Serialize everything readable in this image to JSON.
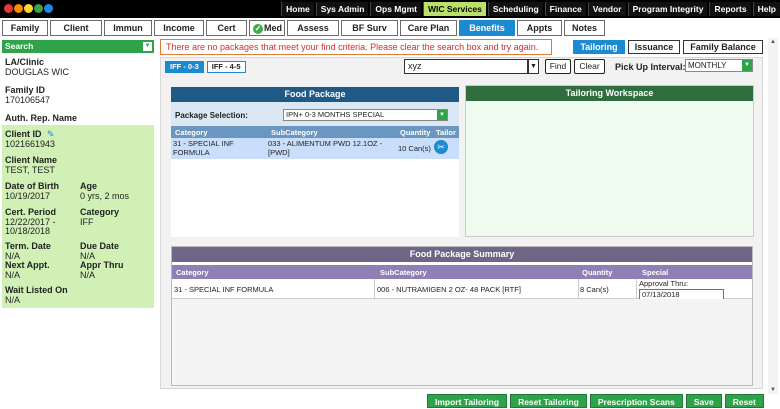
{
  "top_nav": [
    "Home",
    "Sys Admin",
    "Ops Mgmt",
    "WIC Services",
    "Scheduling",
    "Finance",
    "Vendor",
    "Program Integrity",
    "Reports",
    "Help"
  ],
  "top_nav_active": "WIC Services",
  "main_nav": [
    "Family",
    "Client",
    "Immun",
    "Income",
    "Cert",
    "Med",
    "Assess",
    "BF Surv",
    "Care Plan",
    "Benefits",
    "Appts",
    "Notes"
  ],
  "main_nav_active": "Benefits",
  "sidebar": {
    "search_label": "Search",
    "la_clinic_label": "LA/Clinic",
    "la_clinic_value": "DOUGLAS WIC",
    "family_id_label": "Family ID",
    "family_id_value": "170106547",
    "auth_rep_label": "Auth. Rep. Name",
    "client_id_label": "Client ID",
    "client_id_value": "1021661943",
    "client_name_label": "Client Name",
    "client_name_value": "TEST, TEST",
    "dob_label": "Date of Birth",
    "dob_value": "10/19/2017",
    "age_label": "Age",
    "age_value": "0 yrs, 2 mos",
    "cert_period_label": "Cert. Period",
    "cert_period_value_1": "12/22/2017 -",
    "cert_period_value_2": "10/18/2018",
    "category_label": "Category",
    "category_value": "IFF",
    "term_date_label": "Term. Date",
    "term_date_value": "N/A",
    "due_date_label": "Due Date",
    "due_date_value": "N/A",
    "next_appt_label": "Next Appt.",
    "next_appt_value": "N/A",
    "appr_thru_label": "Appr Thru",
    "appr_thru_value": "N/A",
    "wait_listed_label": "Wait Listed On",
    "wait_listed_value": "N/A"
  },
  "message": "There are no packages that meet your find criteria. Please clear the search box and try again.",
  "right_tabs": [
    "Tailoring",
    "Issuance",
    "Family Balance"
  ],
  "right_tabs_active": "Tailoring",
  "sub_tabs": [
    "IFF - 0-3",
    "IFF - 4-5"
  ],
  "sub_tabs_active": "IFF - 0-3",
  "search": {
    "value": "xyz",
    "find_label": "Find",
    "clear_label": "Clear"
  },
  "pickup": {
    "label": "Pick Up Interval:",
    "value": "MONTHLY"
  },
  "food_package": {
    "title": "Food Package",
    "selection_label": "Package Selection:",
    "selection_value": "IPN+ 0-3 MONTHS SPECIAL",
    "columns": [
      "Category",
      "SubCategory",
      "Quantity",
      "Tailor"
    ],
    "row": {
      "category_1": "31 - SPECIAL INF",
      "category_2": "FORMULA",
      "subcategory_1": "033 - ALIMENTUM PWD 12.1OZ -",
      "subcategory_2": "[PWD]",
      "quantity": "10 Can(s)"
    }
  },
  "tailoring_workspace": {
    "title": "Tailoring Workspace"
  },
  "summary": {
    "title": "Food Package Summary",
    "columns": [
      "Category",
      "SubCategory",
      "Quantity",
      "Special"
    ],
    "row": {
      "category": "31 - SPECIAL INF FORMULA",
      "subcategory": "006 - NUTRAMIGEN 2 OZ- 48 PACK [RTF]",
      "quantity": "8 Can(s)",
      "approval_label": "Approval Thru:",
      "approval_value": "07/13/2018"
    }
  },
  "bottom_buttons": [
    "Import Tailoring",
    "Reset Tailoring",
    "Prescription Scans",
    "Save",
    "Reset"
  ]
}
